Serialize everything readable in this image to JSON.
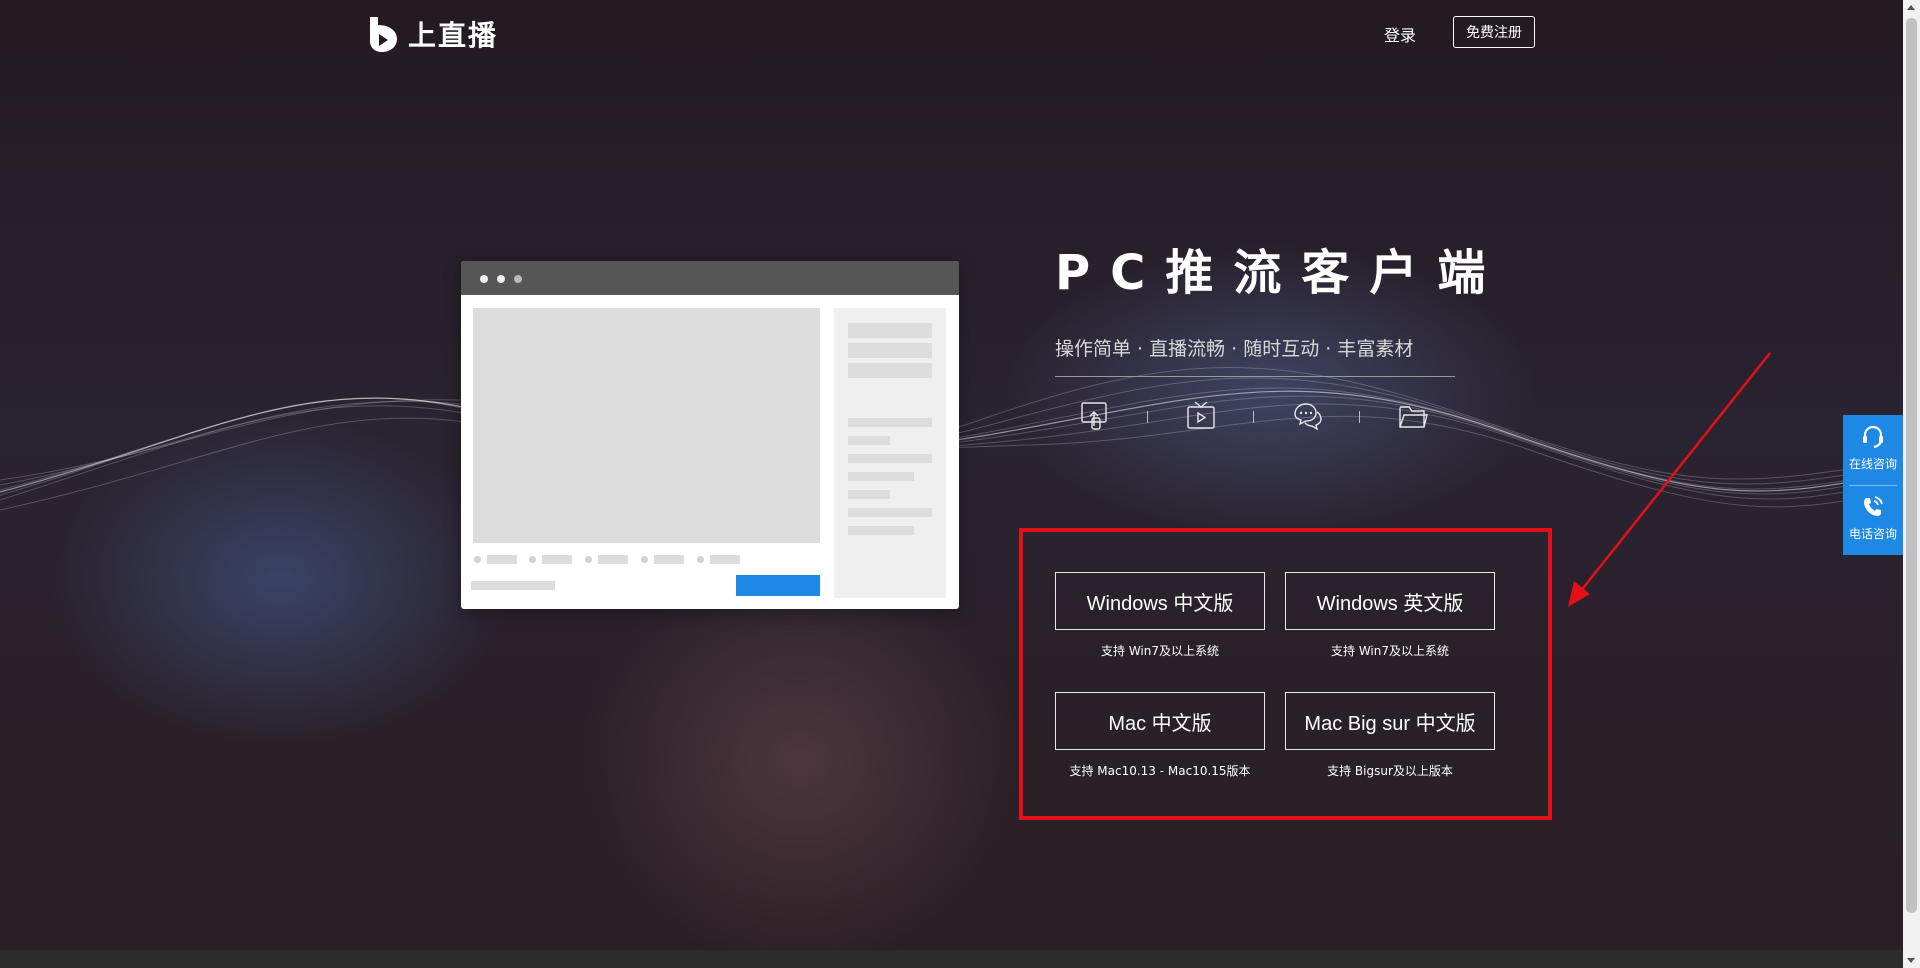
{
  "header": {
    "logo_text": "上直播",
    "login": "登录",
    "register": "免费注册"
  },
  "hero": {
    "title": "PC推流客户端",
    "subtitle": "操作简单 · 直播流畅 · 随时互动 · 丰富素材",
    "feature_icons": [
      "pc-upload-icon",
      "tv-play-icon",
      "chat-bubbles-icon",
      "folder-icon"
    ]
  },
  "downloads": [
    {
      "label": "Windows 中文版",
      "note": "支持 Win7及以上系统"
    },
    {
      "label": "Windows 英文版",
      "note": "支持 Win7及以上系统"
    },
    {
      "label": "Mac 中文版",
      "note": "支持 Mac10.13 - Mac10.15版本"
    },
    {
      "label": "Mac Big sur 中文版",
      "note": "支持 Bigsur及以上版本"
    }
  ],
  "float_panel": {
    "online": "在线咨询",
    "phone": "电话咨询"
  },
  "colors": {
    "accent": "#1e88e5",
    "highlight": "#e3101a",
    "background": "#241a22"
  }
}
